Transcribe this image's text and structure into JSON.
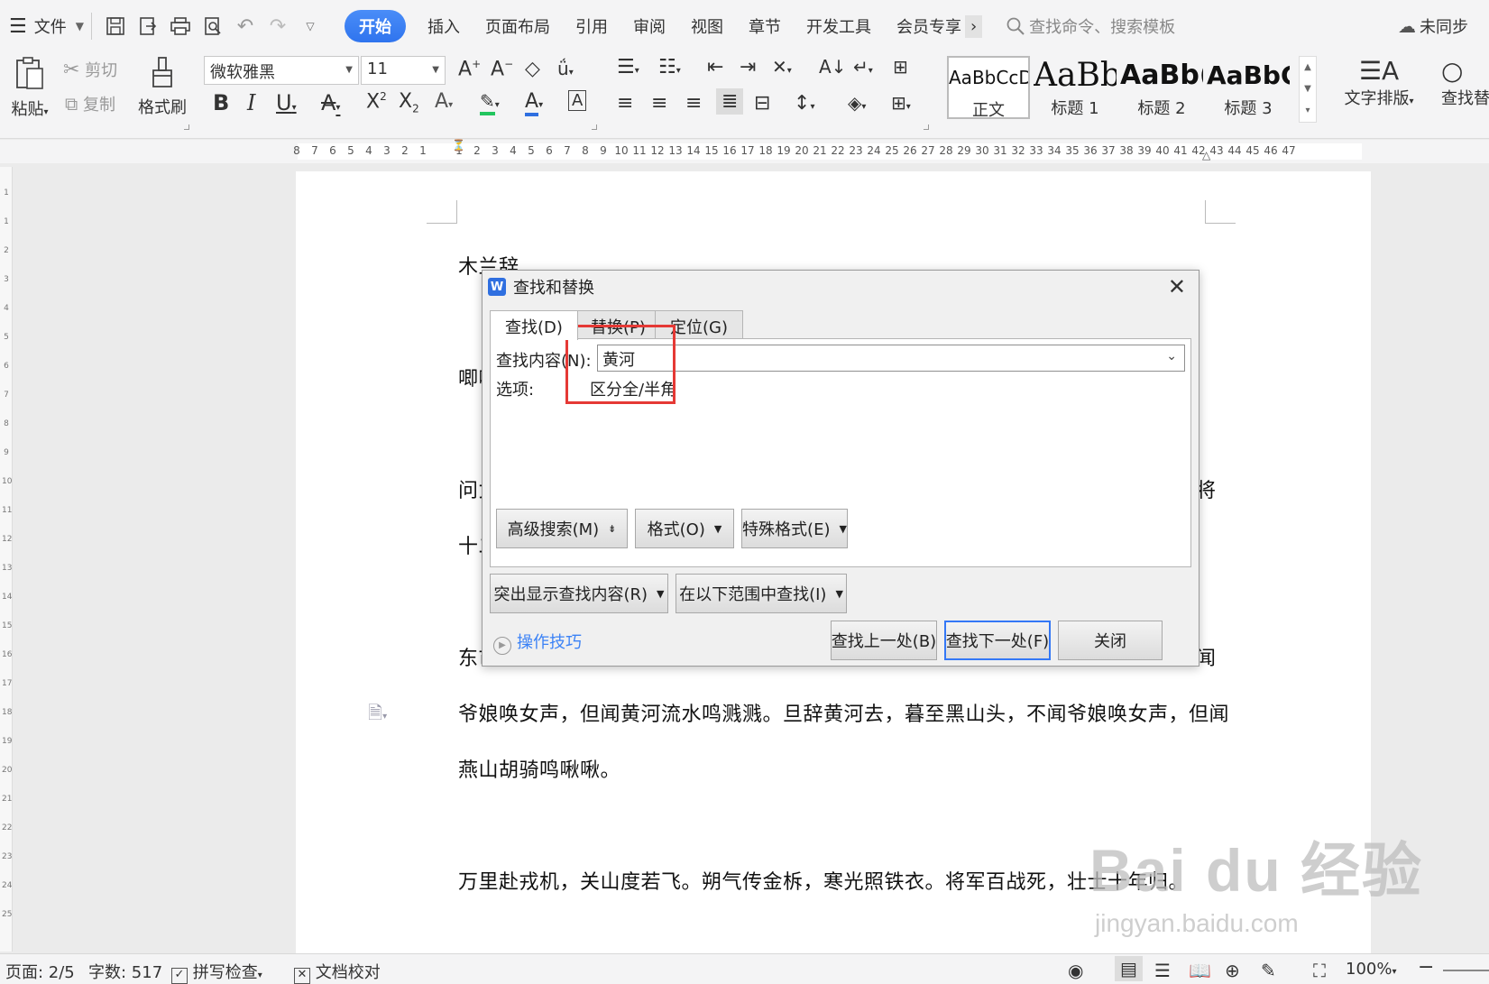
{
  "menubar": {
    "file_label": "文件",
    "tabs": [
      "开始",
      "插入",
      "页面布局",
      "引用",
      "审阅",
      "视图",
      "章节",
      "开发工具",
      "会员专享"
    ],
    "more": "›",
    "search_placeholder": "查找命令、搜索模板",
    "sync_label": "未同步"
  },
  "ribbon": {
    "paste": "粘贴",
    "cut": "剪切",
    "copy": "复制",
    "format_painter": "格式刷",
    "font_name": "微软雅黑",
    "font_size": "11",
    "styles": [
      {
        "sample": "AaBbCcDd",
        "name": "正文"
      },
      {
        "sample": "AaBb",
        "name": "标题 1"
      },
      {
        "sample": "AaBb(",
        "name": "标题 2"
      },
      {
        "sample": "AaBbC",
        "name": "标题 3"
      }
    ],
    "text_layout": "文字排版",
    "find_replace": "查找替换"
  },
  "ruler": {
    "ticks": [
      "8",
      "7",
      "6",
      "5",
      "4",
      "3",
      "2",
      "1",
      "",
      "1",
      "2",
      "3",
      "4",
      "5",
      "6",
      "7",
      "8",
      "9",
      "10",
      "11",
      "12",
      "13",
      "14",
      "15",
      "16",
      "17",
      "18",
      "19",
      "20",
      "21",
      "22",
      "23",
      "24",
      "25",
      "26",
      "27",
      "28",
      "29",
      "30",
      "31",
      "32",
      "33",
      "34",
      "35",
      "36",
      "37",
      "38",
      "39",
      "40",
      "41",
      "42",
      "43",
      "44",
      "45",
      "46",
      "47"
    ]
  },
  "vruler": {
    "ticks": [
      "1",
      "1",
      "2",
      "3",
      "4",
      "5",
      "6",
      "7",
      "8",
      "9",
      "10",
      "11",
      "12",
      "13",
      "14",
      "15",
      "16",
      "17",
      "18",
      "19",
      "20",
      "21",
      "22",
      "23",
      "24",
      "25"
    ]
  },
  "document": {
    "title": "木兰辞",
    "line_2": "唧唧",
    "line_3_start": "问女",
    "line_3_end": "将",
    "line_4": "十二",
    "line_5_start": "东市",
    "line_5_end": "闻",
    "line_6": "爷娘唤女声，但闻黄河流水鸣溅溅。旦辞黄河去，暮至黑山头，不闻爷娘唤女声，但闻",
    "line_7": "燕山胡骑鸣啾啾。",
    "line_8": "万里赴戎机，关山度若飞。朔气传金柝，寒光照铁衣。将军百战死，壮士十年归。"
  },
  "dialog": {
    "title": "查找和替换",
    "tabs": [
      "查找(D)",
      "替换(P)",
      "定位(G)"
    ],
    "find_label": "查找内容(N):",
    "find_value": "黄河",
    "options_label": "选项:",
    "options_value": "区分全/半角",
    "advanced_search": "高级搜索(M)",
    "format": "格式(O)",
    "special_format": "特殊格式(E)",
    "highlight": "突出显示查找内容(R)",
    "find_in": "在以下范围中查找(I)",
    "tips": "操作技巧",
    "find_prev": "查找上一处(B)",
    "find_next": "查找下一处(F)",
    "close": "关闭",
    "highlight_color": "#e53935"
  },
  "statusbar": {
    "page": "页面: 2/5",
    "words": "字数: 517",
    "spell_check": "拼写检查",
    "doc_proof": "文档校对",
    "zoom": "100%"
  },
  "watermark": {
    "brand": "Bai du 经验",
    "url": "jingyan.baidu.com"
  }
}
